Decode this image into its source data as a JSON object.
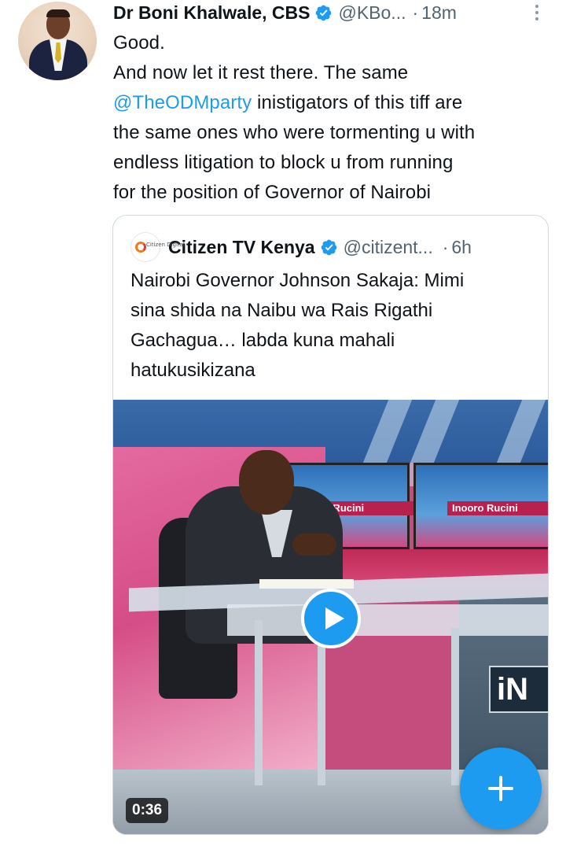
{
  "tweet": {
    "author_name": "Dr Boni Khalwale, CBS",
    "handle": "@KBo...",
    "separator": "·",
    "time": "18m",
    "lines": [
      {
        "text": "Good."
      },
      {
        "text": "And now let it rest there. The same"
      },
      {
        "mention": "@TheODMparty",
        "text": " inistigators of this tiff are"
      },
      {
        "text": "the same ones who were tormenting u with"
      },
      {
        "text": "endless litigation to block u from running"
      },
      {
        "text": "for the position of Governor of Nairobi"
      }
    ]
  },
  "quote": {
    "logo_text": "Citizen Digital",
    "author_name": "Citizen TV Kenya",
    "handle": "@citizent...",
    "separator": "·",
    "time": "6h",
    "lines": [
      "Nairobi Governor Johnson Sakaja: Mimi",
      "sina shida na Naibu wa Rais Rigathi",
      "Gachagua… labda kuna mahali",
      "hatukusikizana"
    ],
    "video": {
      "screen_text_1": "nooro Rucini",
      "screen_text_2": "Inooro Rucini",
      "wall_text": "iN",
      "duration": "0:36"
    }
  },
  "colors": {
    "accent": "#1d9bf0",
    "text": "#0f1419",
    "secondary": "#536471",
    "border": "#cfd9de"
  },
  "icons": {
    "verified": "verified-badge-icon",
    "more": "more-vertical-icon",
    "play": "play-icon",
    "compose": "plus-icon"
  }
}
